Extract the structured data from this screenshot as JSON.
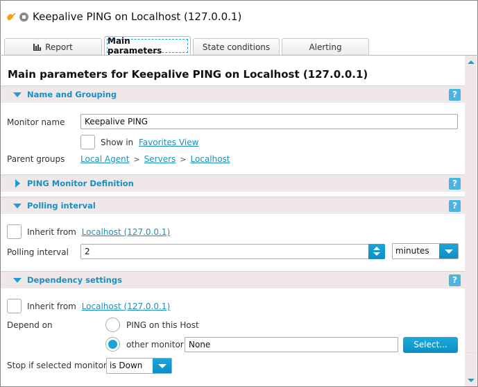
{
  "window": {
    "title": "Keepalive PING on Localhost (127.0.0.1)",
    "icons": [
      "plug-icon",
      "status-stopped-icon"
    ]
  },
  "tabs": [
    {
      "label": "Report",
      "icon": "bar-chart-icon",
      "active": false
    },
    {
      "label": "Main parameters",
      "active": true
    },
    {
      "label": "State conditions",
      "active": false
    },
    {
      "label": "Alerting",
      "active": false
    }
  ],
  "page": {
    "heading": "Main parameters for Keepalive PING on Localhost (127.0.0.1)"
  },
  "sections": {
    "name_grouping": {
      "title": "Name and Grouping",
      "expanded": true,
      "help": "?",
      "monitor_name_label": "Monitor name",
      "monitor_name_value": "Keepalive PING",
      "show_in_label": "Show in",
      "favorites_link": "Favorites View",
      "show_in_checked": false,
      "parent_groups_label": "Parent groups",
      "breadcrumb": [
        "Local Agent",
        "Servers",
        "Localhost"
      ],
      "breadcrumb_sep": ">"
    },
    "ping_definition": {
      "title": "PING Monitor Definition",
      "expanded": false,
      "help": "?"
    },
    "polling": {
      "title": "Polling interval",
      "expanded": true,
      "help": "?",
      "inherit_label": "Inherit from",
      "inherit_link": "Localhost (127.0.0.1)",
      "inherit_checked": false,
      "interval_label": "Polling interval",
      "interval_value": "2",
      "unit_value": "minutes"
    },
    "dependency": {
      "title": "Dependency settings",
      "expanded": true,
      "help": "?",
      "inherit_label": "Inherit from",
      "inherit_link": "Localhost (127.0.0.1)",
      "inherit_checked": false,
      "depend_on_label": "Depend on",
      "option_ping_host": "PING on this Host",
      "option_other_monitor": "other monitor",
      "selected_option": "other monitor",
      "other_monitor_value": "None",
      "select_button": "Select...",
      "stop_if_label": "Stop if selected monitor",
      "stop_if_value": "is Down"
    }
  },
  "colors": {
    "accent": "#1a9fd4",
    "section_bg": "#efe7e8",
    "link": "#1a8fc0"
  }
}
